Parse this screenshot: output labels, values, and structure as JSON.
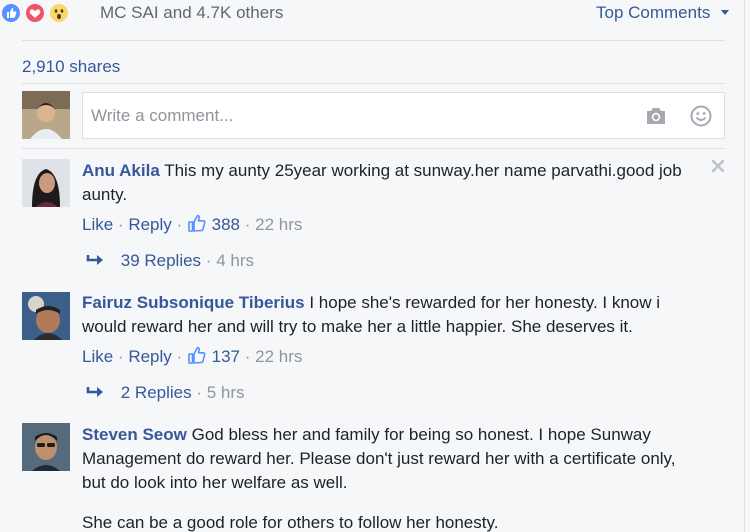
{
  "reactions": {
    "text": "MC SAI and 4.7K others",
    "icons": [
      "like-reaction-icon",
      "love-reaction-icon",
      "wow-reaction-icon"
    ]
  },
  "sort_label": "Top Comments",
  "shares": "2,910 shares",
  "composer": {
    "placeholder": "Write a comment...",
    "icons": [
      "camera-icon",
      "smiley-icon"
    ]
  },
  "comments": [
    {
      "author": "Anu Akila",
      "text": "This my aunty 25year working at sunway.her name parvathi.good job aunty.",
      "like_label": "Like",
      "reply_label": "Reply",
      "likes": "388",
      "time": "22 hrs",
      "replies": "39 Replies",
      "replies_time": "4 hrs"
    },
    {
      "author": "Fairuz Subsonique Tiberius",
      "text": "I hope she's rewarded for her honesty. I know i would reward her and will try to make her a little happier. She deserves it.",
      "like_label": "Like",
      "reply_label": "Reply",
      "likes": "137",
      "time": "22 hrs",
      "replies": "2 Replies",
      "replies_time": "5 hrs"
    },
    {
      "author": "Steven Seow",
      "text": "God bless her and family for being so honest. I hope Sunway Management do reward her. Please don't just reward her with a certificate only, but do look into her welfare as well.",
      "text2": "She can be a good role for others to follow her honesty."
    }
  ],
  "colors": {
    "link": "#365899",
    "muted": "#90949c",
    "bg": "#f6f7f9"
  }
}
